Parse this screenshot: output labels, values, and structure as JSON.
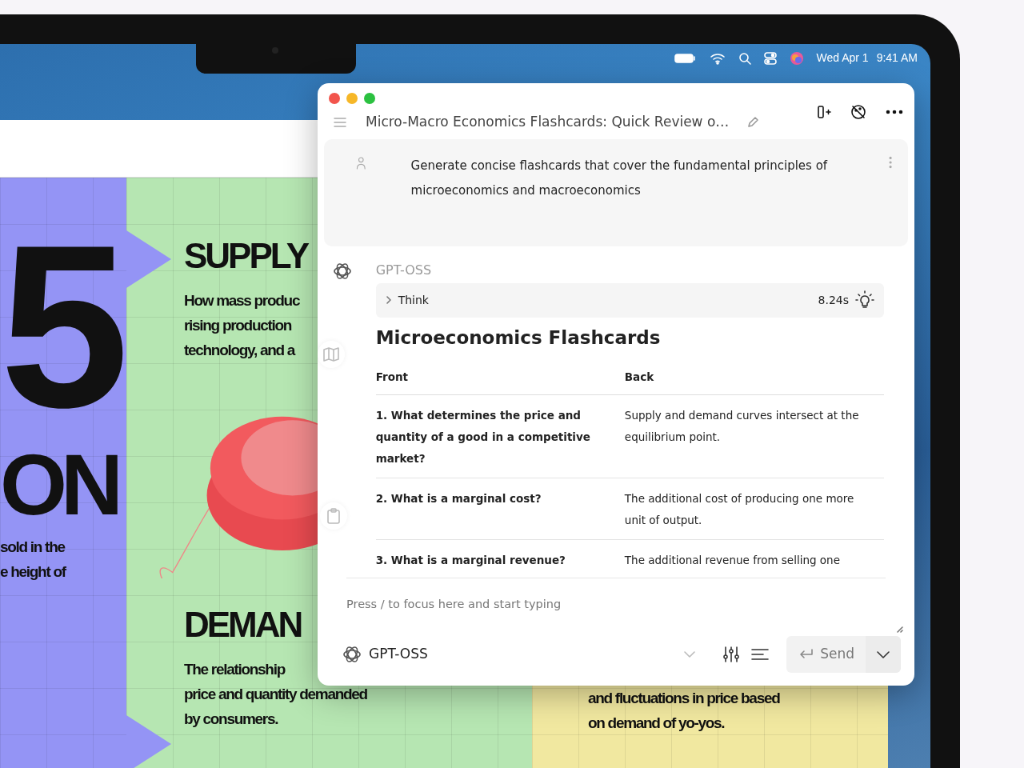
{
  "menu_bar": {
    "date": "Wed Apr 1",
    "time": "9:41 AM"
  },
  "poster": {
    "big_number": "5",
    "big_word": "ON",
    "left_caption": [
      "sold in the",
      "e height of"
    ],
    "sections": [
      {
        "heading": "SUPPLY",
        "lines": [
          "How mass produc",
          "rising production",
          "technology, and a"
        ]
      },
      {
        "heading": "DEMAN",
        "lines": [
          "The relationship",
          "price and quantity demanded",
          "by consumers."
        ]
      }
    ],
    "right_caption": [
      "and fluctuations in price based",
      "on demand of yo-yos."
    ]
  },
  "chat": {
    "title": "Micro-Macro Economics Flashcards: Quick Review o…",
    "user_message": "Generate concise flashcards that cover the fundamental principles of microeconomics and macroeconomics",
    "model_label": "GPT-OSS",
    "think": {
      "label": "Think",
      "expanded": false,
      "duration": "8.24s"
    },
    "heading": "Microeconomics Flashcards",
    "table": {
      "columns": [
        "Front",
        "Back"
      ],
      "rows": [
        [
          "1. What determines the price and quantity of a good in a competitive market?",
          "Supply and demand curves intersect at the equilibrium point."
        ],
        [
          "2. What is a marginal cost?",
          "The additional cost of producing one more unit of output."
        ],
        [
          "3. What is a marginal revenue?",
          "The additional revenue from selling one"
        ]
      ]
    }
  },
  "composer": {
    "placeholder": "Press / to focus here and start typing",
    "model": "GPT-OSS",
    "send": "Send"
  }
}
